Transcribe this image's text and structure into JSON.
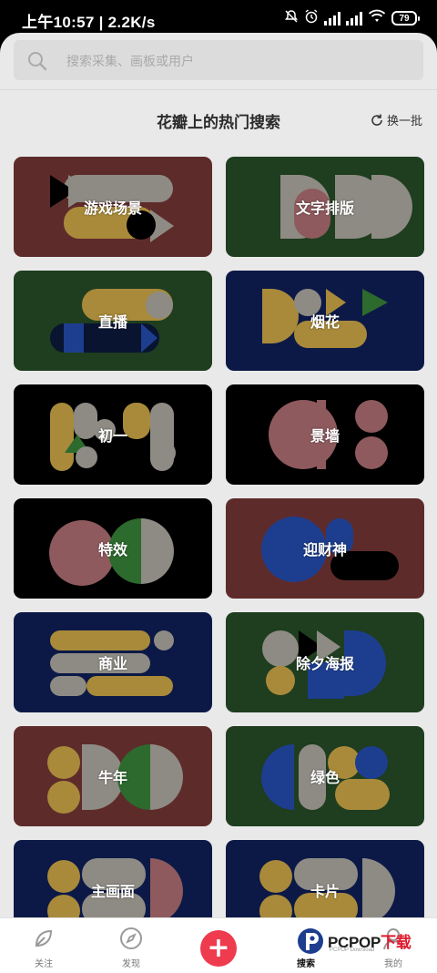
{
  "status": {
    "left": "上午10:57 | 2.2K/s",
    "battery": "79"
  },
  "search": {
    "placeholder": "搜索采集、画板或用户"
  },
  "section": {
    "title": "花瓣上的热门搜索",
    "refresh": "换一批"
  },
  "cards": [
    {
      "label": "游戏场景",
      "bg": "#5e2b2b"
    },
    {
      "label": "文字排版",
      "bg": "#1f3d1f"
    },
    {
      "label": "直播",
      "bg": "#1f3d1f"
    },
    {
      "label": "烟花",
      "bg": "#0c1947"
    },
    {
      "label": "初一",
      "bg": "#000000"
    },
    {
      "label": "景墙",
      "bg": "#000000"
    },
    {
      "label": "特效",
      "bg": "#000000"
    },
    {
      "label": "迎财神",
      "bg": "#5e2b2b"
    },
    {
      "label": "商业",
      "bg": "#0c1947"
    },
    {
      "label": "除夕海报",
      "bg": "#1f3d1f"
    },
    {
      "label": "牛年",
      "bg": "#5e2b2b"
    },
    {
      "label": "绿色",
      "bg": "#1f3d1f"
    },
    {
      "label": "主画面",
      "bg": "#0c1947"
    },
    {
      "label": "卡片",
      "bg": "#0c1947"
    }
  ],
  "nav": {
    "items": [
      {
        "label": "关注",
        "icon": "leaf-icon"
      },
      {
        "label": "发现",
        "icon": "compass-icon"
      },
      {
        "label": "",
        "icon": "plus-icon"
      },
      {
        "label": "搜索",
        "icon": "search-icon"
      },
      {
        "label": "我的",
        "icon": "profile-icon"
      }
    ]
  },
  "watermark": {
    "brand_a": "PCPOP",
    "brand_b": "下载",
    "sub": "PCPOP Download"
  },
  "colors": {
    "accent": "#ee3b4e",
    "ochre": "#a88a3a",
    "grey": "#8e8b84",
    "pink": "#8e5a5e"
  }
}
